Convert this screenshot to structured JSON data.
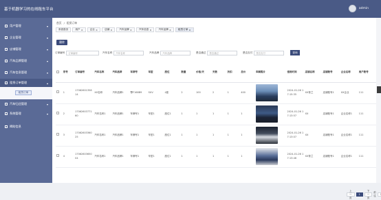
{
  "header": {
    "app_title": "基于机器学习的在线租车平台",
    "username": "admin"
  },
  "sidebar": {
    "items": [
      {
        "label": "用户管理"
      },
      {
        "label": "企业管理"
      },
      {
        "label": "店铺管理"
      },
      {
        "label": "汽车品牌管理"
      },
      {
        "label": "汽车信息管理"
      },
      {
        "label": "租赁订单管理"
      },
      {
        "label": "汽车归还管理"
      },
      {
        "label": "系统管理"
      },
      {
        "label": "揭助信息"
      }
    ],
    "sub_item": "租赁订单"
  },
  "breadcrumb": {
    "home": "首页",
    "separator": "/",
    "current": "租赁订单"
  },
  "tabs": [
    "系统首页",
    "用户",
    "企业",
    "店铺",
    "汽车品牌",
    "汽车信息",
    "汽车品牌",
    "租赁订单"
  ],
  "toolbar": {
    "delete_label": "删除",
    "search_label": "查询"
  },
  "filters": [
    {
      "label": "订单编号",
      "placeholder": "订单编号"
    },
    {
      "label": "汽车名称",
      "placeholder": "汽车名称"
    },
    {
      "label": "汽车品牌",
      "placeholder": "汽车品牌"
    },
    {
      "label": "是否通过",
      "placeholder": "是否通过"
    },
    {
      "label": "是否支付",
      "placeholder": "是否支付"
    }
  ],
  "table": {
    "columns": [
      "序号",
      "订单编号",
      "汽车名称",
      "汽车品牌",
      "车牌号",
      "车型",
      "座位",
      "数量",
      "价格/天",
      "天数",
      "折扣",
      "总价",
      "车辆照片",
      "借用时间",
      "店铺名称",
      "店铺账号",
      "企业名称",
      "用户账号"
    ],
    "rows": [
      [
        "1",
        "1706260135814",
        "XX名称",
        "汽车品牌1",
        "鄂F168B9",
        "SUV",
        "4座",
        "2",
        "100",
        "2",
        "1",
        "400",
        "",
        "2024-01-26 17:15:35",
        "XX鲁兰",
        "店铺账号1",
        "XX企业",
        "111"
      ],
      [
        "2",
        "1706260377160",
        "汽车名称1",
        "汽车品牌1",
        "车牌号1",
        "车型1",
        "座位1",
        "1",
        "1",
        "1",
        "1",
        "1",
        "",
        "2024-01-26 17:13:57",
        "XX",
        "店铺账号1",
        "企业名称1",
        "111"
      ],
      [
        "3",
        "1706260336025",
        "汽车名称1",
        "汽车品牌1",
        "车牌号1",
        "车型1",
        "座位1",
        "1",
        "1",
        "1",
        "1",
        "1",
        "",
        "2024-01-26 17:13:07",
        "XX",
        "店铺账号1",
        "企业名称1",
        "111"
      ],
      [
        "4",
        "1706260365004",
        "汽车名称1",
        "汽车品牌1",
        "车牌号1",
        "车型1",
        "座位1",
        "1",
        "1",
        "1",
        "1",
        "1",
        "",
        "2024-01-26 17:13:46",
        "XX鲁兰",
        "店铺账号1",
        "企业名称1",
        "111"
      ]
    ]
  },
  "pagination": {
    "prev": "上一页",
    "current": "1",
    "next": "下一页",
    "prev_page": "前往",
    "page": "页"
  }
}
